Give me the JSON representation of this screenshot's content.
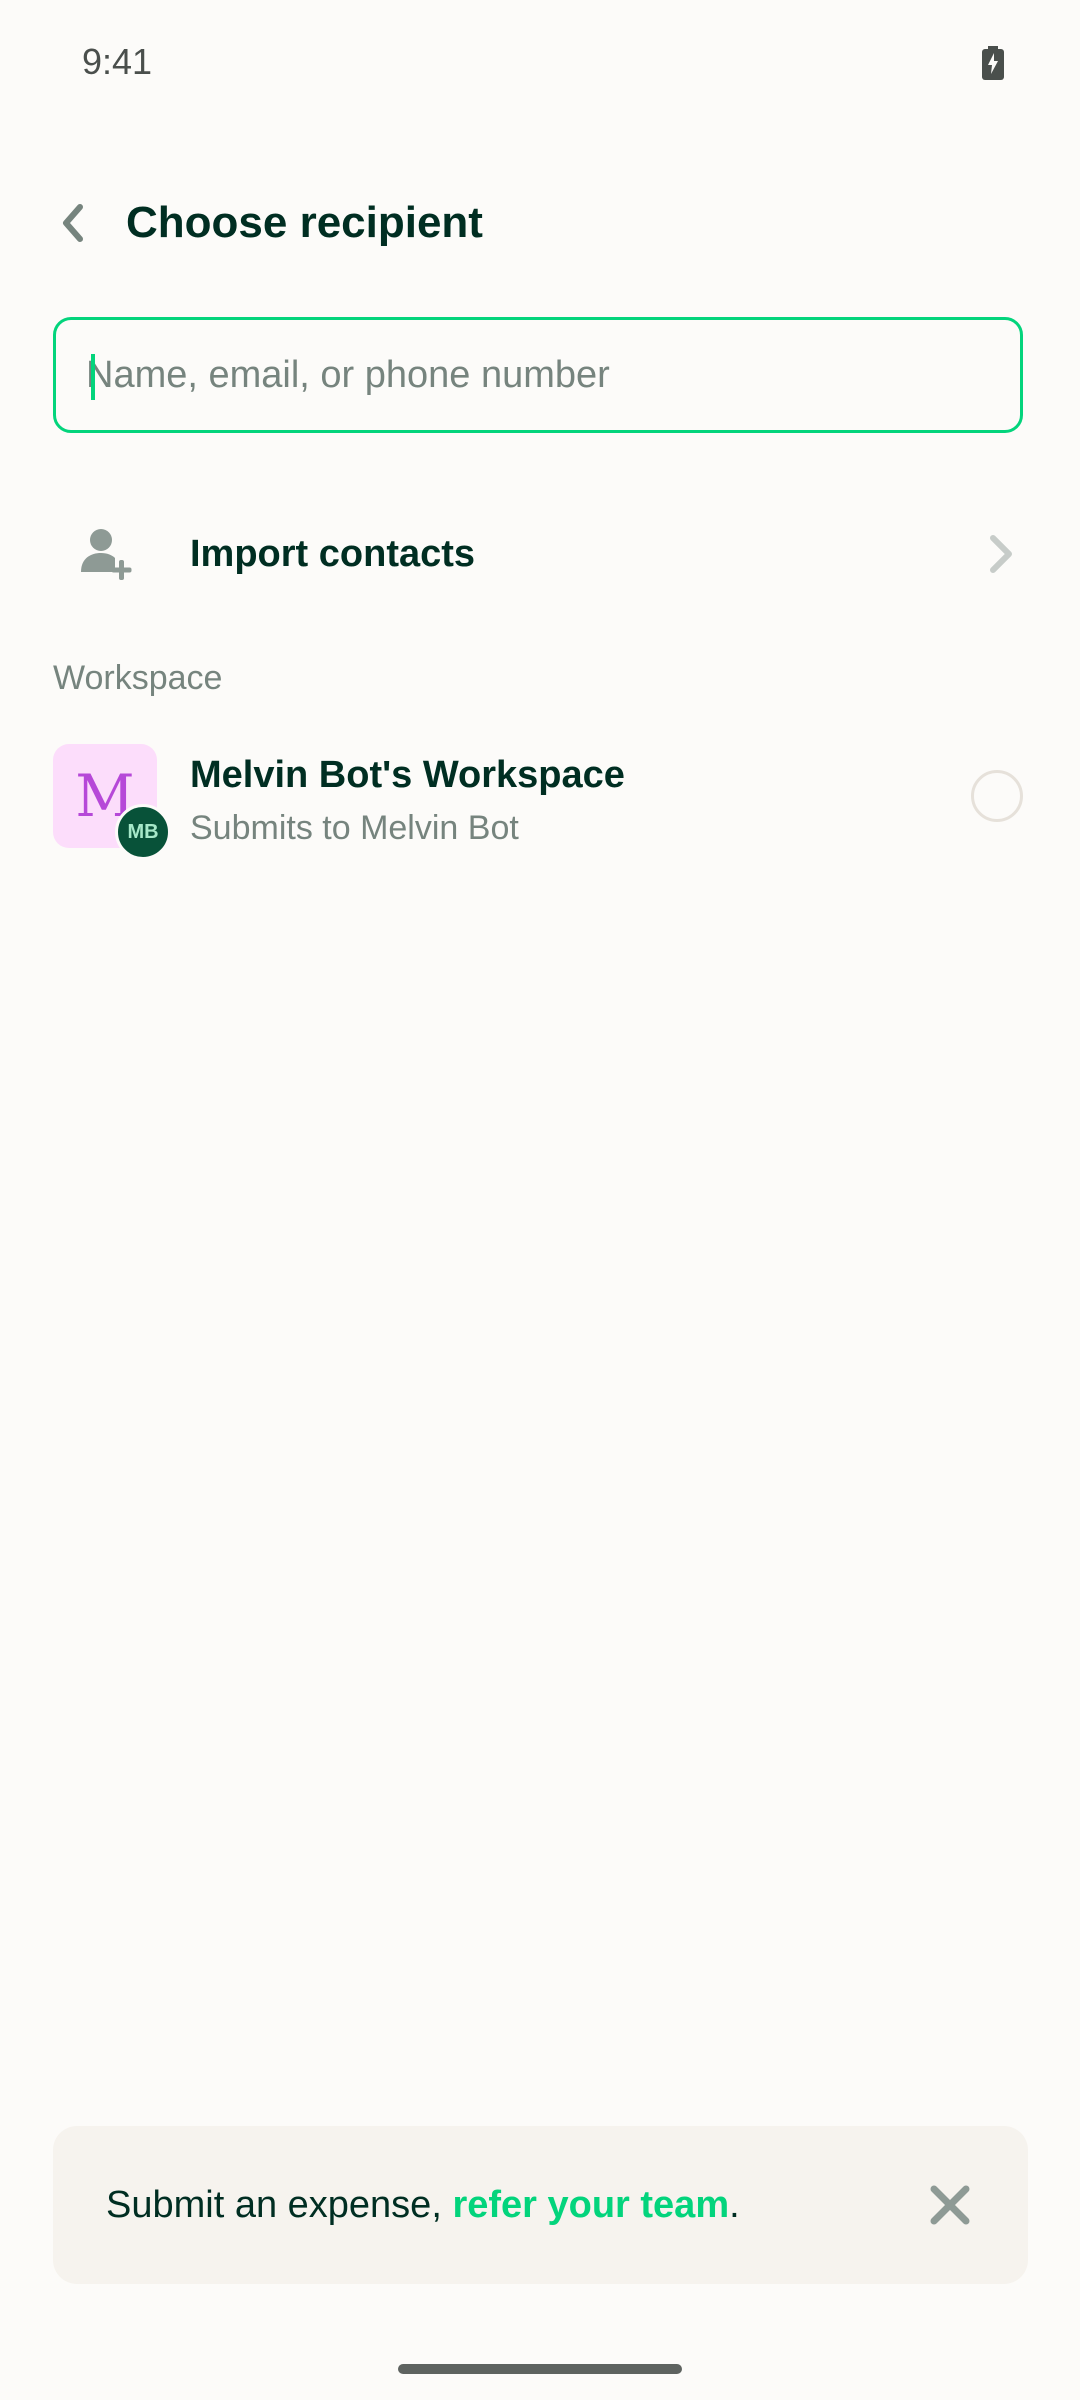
{
  "status_bar": {
    "time": "9:41",
    "battery_icon": "battery-charging-icon"
  },
  "header": {
    "back_icon": "chevron-left-icon",
    "title": "Choose recipient"
  },
  "search": {
    "placeholder": "Name, email, or phone number",
    "value": ""
  },
  "import_contacts": {
    "icon": "add-person-icon",
    "label": "Import contacts",
    "chevron_icon": "chevron-right-icon"
  },
  "workspace_section": {
    "label": "Workspace",
    "items": [
      {
        "avatar_letter": "M",
        "owner_initials": "MB",
        "name": "Melvin Bot's Workspace",
        "description": "Submits to Melvin Bot",
        "selected": false
      }
    ]
  },
  "banner": {
    "text_prefix": "Submit an expense, ",
    "link_text": "refer your team",
    "text_suffix": ".",
    "close_icon": "close-icon"
  },
  "colors": {
    "accent": "#03D47C",
    "text_primary": "#002E22",
    "text_secondary": "#76847E",
    "background": "#FCFBF9",
    "workspace_avatar_bg": "#FCDDFB",
    "workspace_avatar_fg": "#B648D8",
    "owner_avatar_bg": "#085239"
  }
}
